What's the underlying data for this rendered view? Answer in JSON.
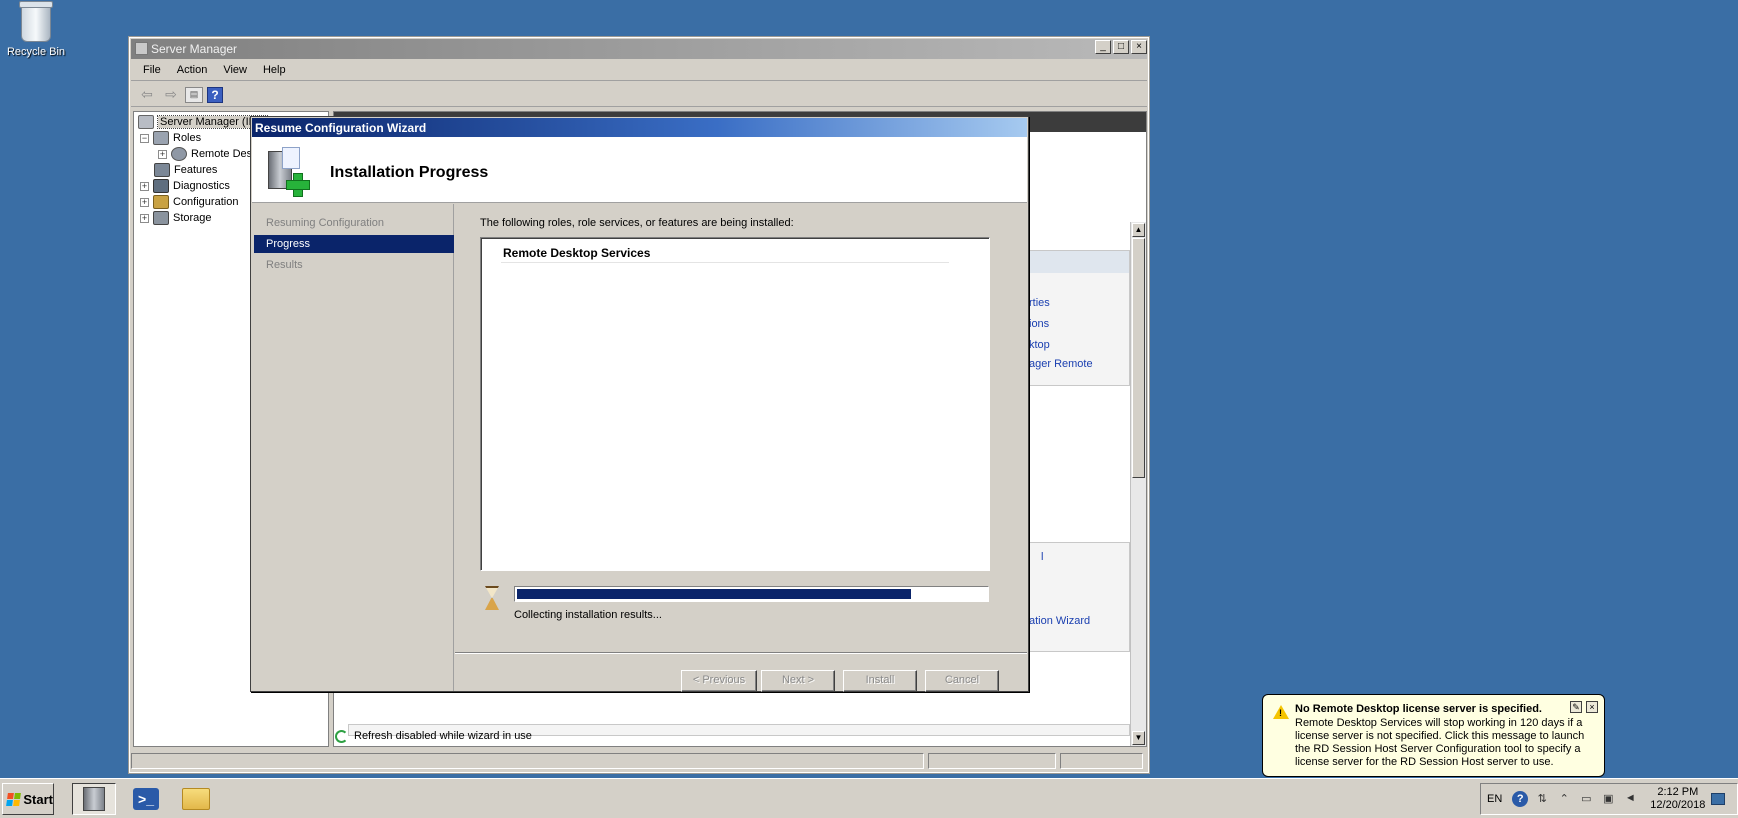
{
  "desktop": {
    "recycle_bin_label": "Recycle Bin"
  },
  "server_manager": {
    "title": "Server Manager",
    "window_buttons": {
      "minimize": "_",
      "maximize": "□",
      "close": "×"
    },
    "menu": [
      "File",
      "Action",
      "View",
      "Help"
    ],
    "tree": {
      "root": "Server Manager (IE...",
      "roles": "Roles",
      "remote_desktop": "Remote Des",
      "features": "Features",
      "diagnostics": "Diagnostics",
      "configuration": "Configuration",
      "storage": "Storage"
    },
    "right_links": [
      "rties",
      "ions",
      "ktop",
      "ager Remote",
      "l",
      "ation Wizard"
    ],
    "refresh_text": "Refresh disabled while wizard in use"
  },
  "wizard": {
    "title": "Resume Configuration Wizard",
    "heading": "Installation Progress",
    "nav": [
      "Resuming Configuration",
      "Progress",
      "Results"
    ],
    "active_step": "Progress",
    "description": "The following roles, role services, or features are being installed:",
    "items": [
      "Remote Desktop Services"
    ],
    "progress_fraction": 0.84,
    "progress_text": "Collecting installation results...",
    "buttons": {
      "previous": "< Previous",
      "next": "Next >",
      "install": "Install",
      "cancel": "Cancel"
    }
  },
  "balloon": {
    "title": "No Remote Desktop license server is specified.",
    "text": "Remote Desktop Services will stop working in 120 days if a license server is not specified. Click this message to launch the RD Session Host Server Configuration tool to specify a license server for the RD Session Host server to use."
  },
  "taskbar": {
    "start_label": "Start",
    "language": "EN",
    "time": "2:12 PM",
    "date": "12/20/2018"
  },
  "colors": {
    "desktop": "#3a6ea5",
    "wizard_title": "#0a246a",
    "progress_fill": "#0a246a",
    "balloon_bg": "#ffffe1",
    "link": "#1a3fb0"
  },
  "icons": [
    "recycle-bin-icon",
    "back-arrow-icon",
    "forward-arrow-icon",
    "show-hide-tree-icon",
    "help-icon",
    "hourglass-icon",
    "warning-icon",
    "refresh-icon",
    "powershell-icon",
    "explorer-folder-icon"
  ]
}
